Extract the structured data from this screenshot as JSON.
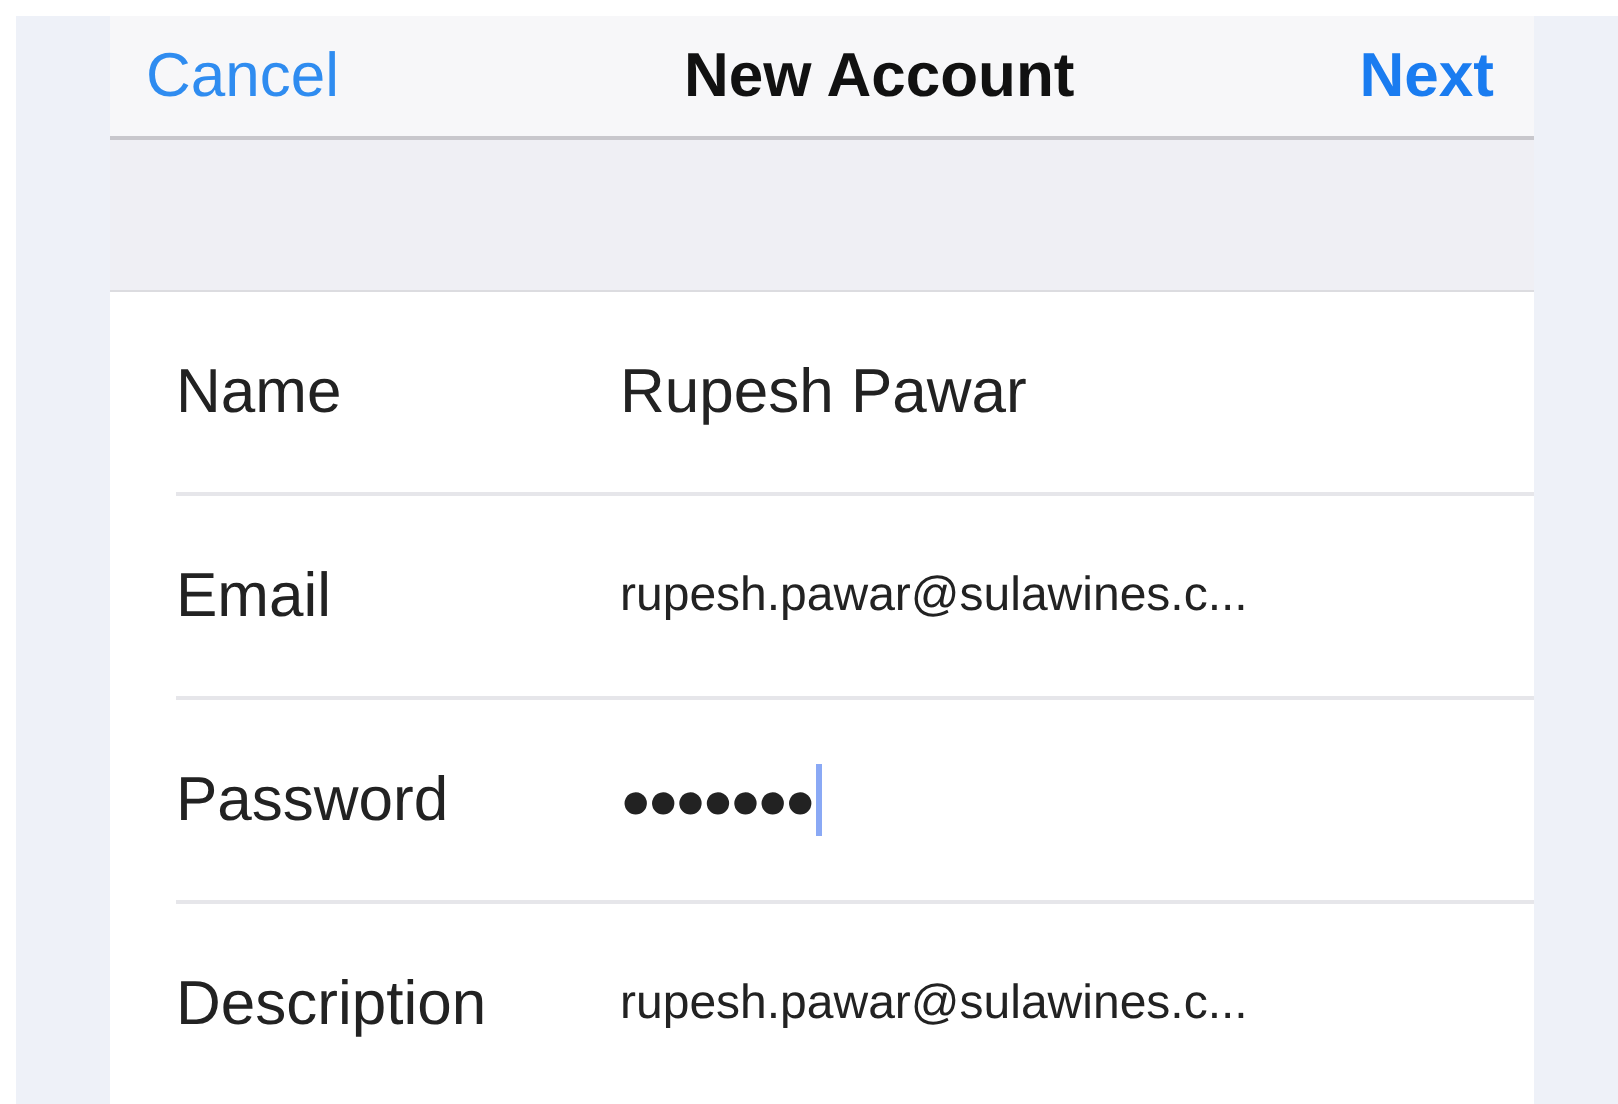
{
  "nav_bar": {
    "cancel": "Cancel",
    "title": "New Account",
    "next": "Next"
  },
  "fields": [
    {
      "label": "Name",
      "value": "Rupesh Pawar",
      "kind": "text",
      "focused": false
    },
    {
      "label": "Email",
      "value": "rupesh.pawar@sulawines.c...",
      "kind": "compact",
      "focused": false
    },
    {
      "label": "Password",
      "value": "●●●●●●●",
      "kind": "secure",
      "focused": true
    },
    {
      "label": "Description",
      "value": "rupesh.pawar@sulawines.c...",
      "kind": "compact",
      "focused": false
    }
  ]
}
